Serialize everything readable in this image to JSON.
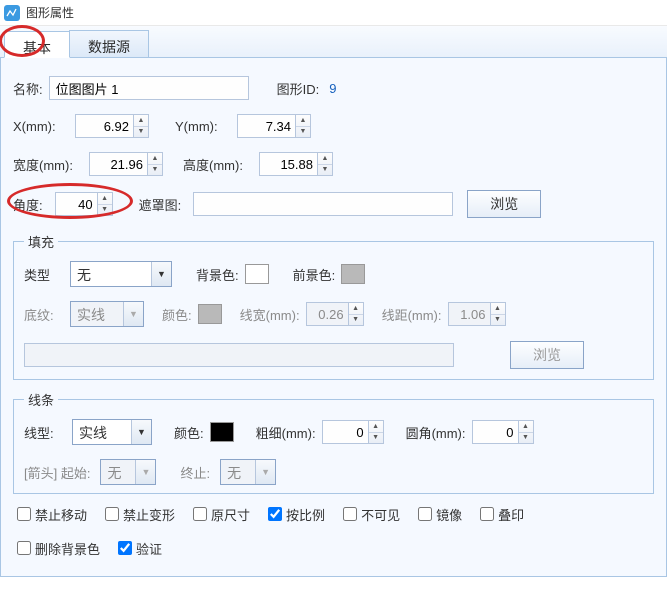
{
  "window": {
    "title": "图形属性"
  },
  "tabs": {
    "basic": "基本",
    "datasource": "数据源"
  },
  "labels": {
    "name": "名称:",
    "graphic_id": "图形ID:",
    "x": "X(mm):",
    "y": "Y(mm):",
    "width": "宽度(mm):",
    "height": "高度(mm):",
    "angle": "角度:",
    "mask": "遮罩图:",
    "browse": "浏览",
    "fill_legend": "填充",
    "fill_type": "类型",
    "bgcolor": "背景色:",
    "fgcolor": "前景色:",
    "pattern": "底纹:",
    "color": "颜色:",
    "line_width": "线宽(mm):",
    "line_gap": "线距(mm):",
    "line_legend": "线条",
    "line_type": "线型:",
    "stroke_width": "粗细(mm):",
    "corner": "圆角(mm):",
    "arrow": "[箭头] 起始:",
    "arrow_end": "终止:"
  },
  "values": {
    "name": "位图图片 1",
    "graphic_id": "9",
    "x": "6.92",
    "y": "7.34",
    "width": "21.96",
    "height": "15.88",
    "angle": "40",
    "mask": "",
    "fill_type": "无",
    "pattern": "实线",
    "line_width": "0.26",
    "line_gap": "1.06",
    "texture_path": "",
    "line_type": "实线",
    "stroke_width": "0",
    "corner": "0",
    "arrow_start": "无",
    "arrow_end": "无"
  },
  "colors": {
    "bg": "#ffffff",
    "fg": "#b9b9b9",
    "pattern_color": "#b9b9b9",
    "stroke": "#000000"
  },
  "checks": {
    "lock_move": "禁止移动",
    "lock_resize": "禁止变形",
    "orig_size": "原尺寸",
    "proportional": "按比例",
    "invisible": "不可见",
    "mirror": "镜像",
    "overprint": "叠印",
    "remove_bg": "删除背景色",
    "validate": "验证"
  }
}
